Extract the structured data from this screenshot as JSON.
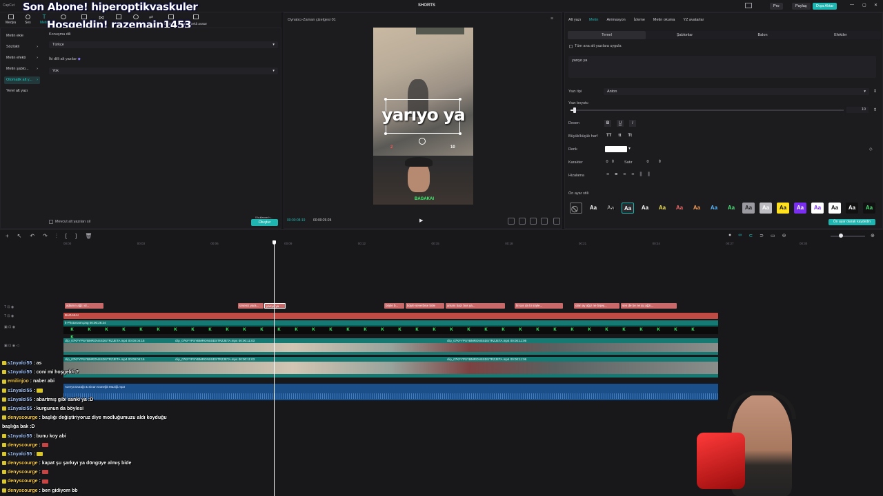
{
  "titlebar": {
    "app": "CapCut",
    "center": "SHORTS",
    "pro": "Pro",
    "share": "Paylaş",
    "export": "Dışa Aktar"
  },
  "overlay": {
    "line1": "Son Abone! hiperoptikvaskuler",
    "line2": "Hoşgeldin! razemain1453"
  },
  "toolbar": {
    "items": [
      "Medya",
      "Ses",
      "Metin",
      "Çıkartmalar",
      "Efektler",
      "Geçişler",
      "Filtreler",
      "Ayarla",
      "Şablonlar",
      "Yapay zekâ avatar"
    ]
  },
  "left_panel": {
    "menu": [
      "Metin ekle",
      "Sözlükli",
      "Metin efekti",
      "Metin şablo...",
      "Otomatik alt y...",
      "Yerel alt yazı"
    ],
    "speech_lang_label": "Konuşma dili",
    "speech_lang_value": "Türkçe",
    "bilingual_label": "İki dilli alt yazılar",
    "bilingual_value": "Yok",
    "clear_label": "Mevcut alt yazıları sil",
    "generate_btn": "Oluştur",
    "usage_badge": "0 kullanım h..."
  },
  "player": {
    "title": "Oynatıcı-Zaman çizelgesi 01",
    "caption": "yarıyo ya",
    "current_time": "00:00:08:19",
    "total_time": "00:00:26:24",
    "hud_left": "2",
    "hud_right": "10",
    "webcam_tag": "BAGAKAI"
  },
  "right_panel": {
    "tabs": [
      "Alt yazı",
      "Metin",
      "Animasyon",
      "İzleme",
      "Metin okuma",
      "YZ avatarlar"
    ],
    "subtabs": [
      "Temel",
      "Şablonlar",
      "Balon",
      "Efektler"
    ],
    "apply_all": "Tüm ana alt yazılara uygula",
    "text_value": "yarıyo ya",
    "font_label": "Yazı tipi",
    "font_value": "Anton",
    "size_label": "Yazı boyutu",
    "size_value": "10",
    "pattern_label": "Desen",
    "case_label": "Büyük/küçük harf",
    "color_label": "Renk",
    "char_label": "Karakter",
    "char_value": "0",
    "line_label": "Satır",
    "line_value": "0",
    "align_label": "Hizalama",
    "preset_label": "Ön ayar stili",
    "save_preset": "Ön ayar olarak kaydedin",
    "style_sample": "Aa"
  },
  "timeline": {
    "ticks": [
      "00:00",
      "00:03",
      "00:06",
      "00:09",
      "00:12",
      "00:15",
      "00:18",
      "00:21",
      "00:24",
      "00:27",
      "00:30"
    ],
    "text_clips": [
      "adamın ağzı ol...",
      "ürseniz yara...",
      "yarıyo ya",
      "böyle b...",
      "böyle severbise böle",
      "amanı bazı bus ya...",
      "bi sus da bi söyle...",
      "olan ay ağız ne bişey...",
      "sen de be ne şu ağzı..."
    ],
    "title_clip": "BAGAKAI",
    "image_clip": "k-Photoroom.png  00:00:26:24",
    "video_a1": "clip_07KFYPSYBMRONSSDSTRZJETA.mp4  00:00:04:15",
    "video_a2": "clip_07KFYPSYBMRONSSDSTRZJETA.mp4  00:00:11:03",
    "video_a3": "clip_07KFYPSYBMRONSSDSTRZJETA.mp4  00:00:11:06",
    "audio_clip": "Azerya Durağı & Sinan Güneğit Müziği.mp3"
  },
  "chat": [
    {
      "user": "s1nyalci55",
      "msg": "as",
      "color": "blue"
    },
    {
      "user": "s1nyalci55",
      "msg": "coni mi hoşgeldi ?",
      "color": "blue"
    },
    {
      "user": "emilinjoo",
      "msg": "naber abi",
      "color": "yellow"
    },
    {
      "user": "s1nyalci55",
      "msg": "",
      "color": "blue"
    },
    {
      "user": "s1nyalci55",
      "msg": "abartmış gibi sanki ya :D",
      "color": "blue"
    },
    {
      "user": "s1nyalci55",
      "msg": "kurgunun da böylesi",
      "color": "blue"
    },
    {
      "user": "denyscourge",
      "msg": "başlığı değiştiriyoruz diye modluğumuzu aldı koyduğu",
      "color": "yellow"
    },
    {
      "user": "",
      "msg": "başlığa bak :D",
      "color": "yellow"
    },
    {
      "user": "s1nyalci55",
      "msg": "bunu koy abi",
      "color": "blue"
    },
    {
      "user": "denyscourge",
      "msg": "",
      "color": "yellow"
    },
    {
      "user": "s1nyalci55",
      "msg": "",
      "color": "blue"
    },
    {
      "user": "denyscourge",
      "msg": "kapat şu şarkıyı ya döngüye almış bide",
      "color": "yellow"
    },
    {
      "user": "denyscourge",
      "msg": "",
      "color": "yellow"
    },
    {
      "user": "denyscourge",
      "msg": "",
      "color": "yellow"
    },
    {
      "user": "denyscourge",
      "msg": "ben gidiyom bb",
      "color": "yellow"
    }
  ],
  "colors": {
    "accent": "#1fb5b0",
    "clip_text": "#c96969",
    "clip_title": "#c04a44",
    "video": "#157a73",
    "audio": "#1b4f8a"
  }
}
